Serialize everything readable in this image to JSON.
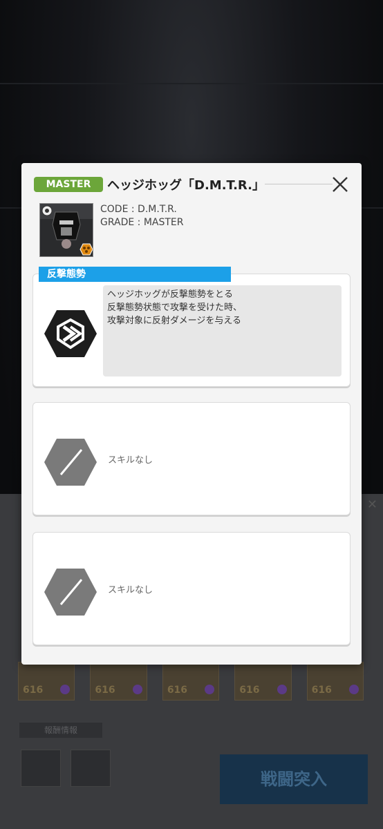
{
  "modal": {
    "grade_badge": "MASTER",
    "title": "ヘッジホッグ「D.M.T.R.」",
    "close_label": "×",
    "code_line": "CODE : D.M.T.R.",
    "grade_line": "GRADE : MASTER"
  },
  "skills": [
    {
      "name": "反撃態勢",
      "description_lines": [
        "ヘッジホッグが反撃態勢をとる",
        "反撃態勢状態で攻撃を受けた時、",
        "攻撃対象に反射ダメージを与える"
      ],
      "icon": "counter-stance-icon"
    },
    {
      "empty_label": "スキルなし",
      "icon": "no-skill-icon"
    },
    {
      "empty_label": "スキルなし",
      "icon": "no-skill-icon"
    }
  ],
  "background": {
    "card_labels": [
      "616",
      "616",
      "616",
      "616",
      "616"
    ],
    "reward_label": "報酬情報",
    "battle_button": "戦闘突入"
  },
  "colors": {
    "grade_badge": "#6ca63a",
    "skill_tab": "#1ca0e8",
    "modal_bg": "#f4f4f4"
  }
}
